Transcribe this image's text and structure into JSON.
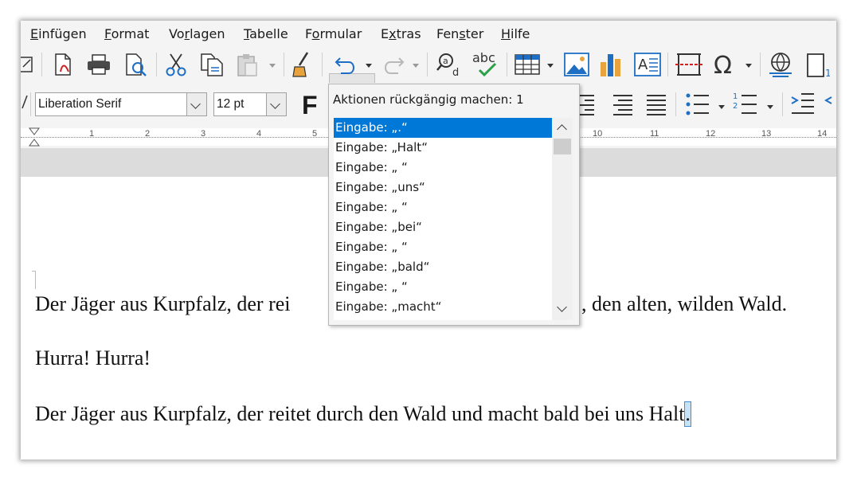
{
  "menu": [
    "Einfügen",
    "Format",
    "Vorlagen",
    "Tabelle",
    "Formular",
    "Extras",
    "Fenster",
    "Hilfe"
  ],
  "font_name": "Liberation Serif",
  "font_size": "12 pt",
  "bold_label": "F",
  "ruler_numbers": [
    "1",
    "2",
    "3",
    "4",
    "5",
    "10",
    "11",
    "12",
    "13",
    "14"
  ],
  "undo_popup": {
    "title": "Aktionen rückgängig machen: 1",
    "items": [
      "Eingabe: „.“",
      "Eingabe: „Halt“",
      "Eingabe: „ “",
      "Eingabe: „uns“",
      "Eingabe: „ “",
      "Eingabe: „bei“",
      "Eingabe: „ “",
      "Eingabe: „bald“",
      "Eingabe: „ “",
      "Eingabe: „macht“"
    ],
    "selected_count": 1
  },
  "document": {
    "line1_left": "Der Jäger aus Kurpfalz, der rei",
    "line1_right": ", den alten, wilden Wald.",
    "line2": "Hurra! Hurra!",
    "line3_main": "Der Jäger aus Kurpfalz, der reitet durch den Wald und macht bald bei uns Halt",
    "line3_selected": "."
  },
  "colors": {
    "selection": "#0078d7",
    "accent_blue": "#1e6fc4",
    "chart_orange": "#e8a33c"
  }
}
